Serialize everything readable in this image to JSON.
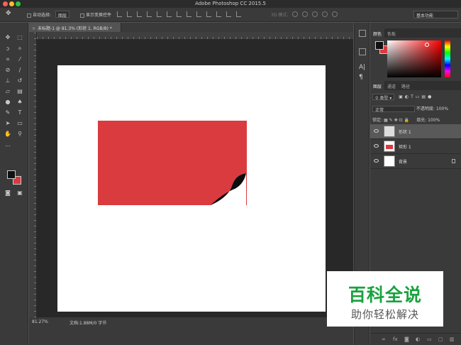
{
  "window": {
    "title": "Adobe Photoshop CC 2015.5"
  },
  "options_bar": {
    "auto_select_label": "自动选择:",
    "auto_select_value": "图层",
    "show_transform_label": "显示变换控件",
    "mode_3d_label": "3D 模式:",
    "workspace_value": "基本功能"
  },
  "document_tab": {
    "title": "未标题-1 @ 81.3% (形状 1, RGB/8) *"
  },
  "status_bar": {
    "zoom": "81.27%",
    "doc_info": "文档:1.88M/0 字节"
  },
  "canvas": {
    "shape_color": "#d93b3f",
    "background_color": "#ffffff"
  },
  "color_panel": {
    "tabs": [
      "颜色",
      "色板"
    ],
    "foreground": "#111111",
    "background": "#d93b3f"
  },
  "layers_panel": {
    "tabs": [
      "图层",
      "通道",
      "路径"
    ],
    "filter_label": "类型",
    "blend_mode": "正常",
    "opacity_label": "不透明度:",
    "opacity_value": "100%",
    "lock_label": "锁定:",
    "fill_label": "填充:",
    "fill_value": "100%",
    "layers": [
      {
        "name": "形状 1",
        "selected": true
      },
      {
        "name": "矩形 1",
        "selected": false
      },
      {
        "name": "背景",
        "selected": false,
        "locked": true
      }
    ],
    "footer_fx": "fx"
  },
  "watermark": {
    "title": "百科全说",
    "subtitle": "助你轻松解决"
  }
}
